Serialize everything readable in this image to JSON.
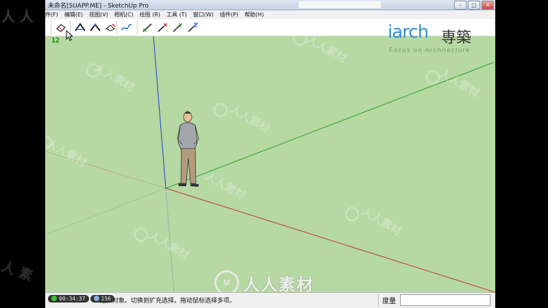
{
  "window": {
    "title": "未命名[SUAPP.ME] - SketchUp Pro",
    "controls": [
      "–",
      "□",
      "✕"
    ]
  },
  "menu": {
    "items": [
      "文件(F)",
      "编辑(E)",
      "视图(V)",
      "相机(C)",
      "绘图 (R)",
      "工具 (T)",
      "窗口(W)",
      "插件(P)",
      "帮助(H)"
    ]
  },
  "toolbar": {
    "groups": [
      {
        "tools": [
          "eraser-tool-icon"
        ]
      },
      {
        "tools": [
          "sandbox-from-contours-icon",
          "sandbox-from-scratch-icon",
          "smoove-icon"
        ]
      },
      {
        "tools": [
          "stamp-icon",
          "drape-icon"
        ]
      },
      {
        "tools": [
          "axis-x-icon",
          "axis-y-icon",
          "axis-z-icon",
          "add-detail-icon"
        ]
      }
    ]
  },
  "logo": {
    "main": "iarch",
    "cn": "専築",
    "sub": "Focus on Architecture"
  },
  "viewport": {
    "scene_label": "12",
    "axis_colors": {
      "red": "#c0392b",
      "green": "#2ea02e",
      "blue": "#1f3fc4"
    },
    "background": "#b6d8a3"
  },
  "statusbar": {
    "hint": "选择对象。切换到扩充选择。拖动鼠标选择多项。",
    "measure_label": "度量",
    "measure_value": ""
  },
  "player": {
    "time": "00:34:37",
    "count": "156"
  },
  "watermark": {
    "text": "人人素材",
    "logo": "M"
  }
}
